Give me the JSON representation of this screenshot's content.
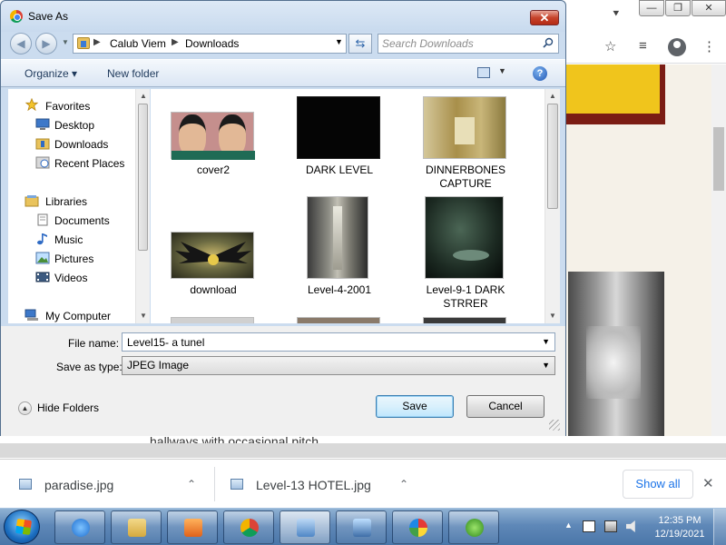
{
  "dialog": {
    "title": "Save As",
    "close_symbol": "✕",
    "address": {
      "segments": [
        "Calub Viem",
        "Downloads"
      ],
      "separator": "▶"
    },
    "search_placeholder": "Search Downloads",
    "toolbar": {
      "organize_label": "Organize ▾",
      "new_folder_label": "New folder",
      "help_symbol": "?"
    },
    "nav_pane": {
      "items": [
        {
          "label": "Favorites",
          "icon": "star-icon"
        },
        {
          "label": "Desktop",
          "icon": "desktop-icon"
        },
        {
          "label": "Downloads",
          "icon": "downloads-folder-icon"
        },
        {
          "label": "Recent Places",
          "icon": "recent-places-icon"
        },
        {
          "label": "Libraries",
          "icon": "libraries-icon"
        },
        {
          "label": "Documents",
          "icon": "documents-icon"
        },
        {
          "label": "Music",
          "icon": "music-icon"
        },
        {
          "label": "Pictures",
          "icon": "pictures-icon"
        },
        {
          "label": "Videos",
          "icon": "videos-icon"
        },
        {
          "label": "My Computer",
          "icon": "computer-icon"
        }
      ]
    },
    "files": [
      {
        "label": "cover2",
        "thumb_color": "#b07a72"
      },
      {
        "label": "DARK LEVEL",
        "thumb_color": "#060606"
      },
      {
        "label": "DINNERBONES CAPTURE",
        "thumb_color": "#b8a25e"
      },
      {
        "label": "download",
        "thumb_color": "#3b3a2a"
      },
      {
        "label": "Level-4-2001",
        "thumb_color": "#7a7a72"
      },
      {
        "label": "Level-9-1 DARK STRRER",
        "thumb_color": "#1f2a23"
      }
    ],
    "file_name_label": "File name:",
    "file_name_value": "Level15- a tunel",
    "save_as_type_label": "Save as type:",
    "save_as_type_value": "JPEG Image",
    "hide_folders_label": "Hide Folders",
    "save_label": "Save",
    "cancel_label": "Cancel"
  },
  "background": {
    "partial_text": "hallways with occasional pitch"
  },
  "downloads_bar": {
    "items": [
      {
        "name": "paradise.jpg"
      },
      {
        "name": "Level-13 HOTEL.jpg"
      }
    ],
    "show_all_label": "Show all",
    "close_symbol": "✕"
  },
  "taskbar": {
    "time": "12:35 PM",
    "date": "12/19/2021",
    "apps": [
      "internet-explorer",
      "file-explorer",
      "media-player",
      "chrome",
      "control-panel",
      "photo-viewer",
      "paint",
      "media-center"
    ]
  },
  "colors": {
    "dialog_frame": "#cbdcef",
    "taskbar": "#5f88b8",
    "link_blue": "#1a73e8"
  }
}
